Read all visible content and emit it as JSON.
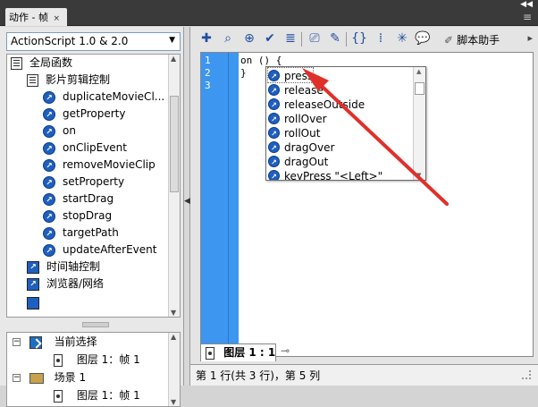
{
  "window": {
    "panel_tab_title": "动作 - 帧",
    "tab_close_glyph": "×",
    "collapse_glyph": "◀◀",
    "menu_glyph": "≡"
  },
  "left_panel": {
    "version_dropdown": {
      "selected": "ActionScript 1.0 & 2.0"
    },
    "tree": {
      "items": [
        {
          "label": "全局函数",
          "icon": "book-icon",
          "level": 0
        },
        {
          "label": "影片剪辑控制",
          "icon": "book-icon",
          "level": 1
        },
        {
          "label": "duplicateMovieCl...",
          "icon": "function-icon",
          "level": 2
        },
        {
          "label": "getProperty",
          "icon": "function-icon",
          "level": 2
        },
        {
          "label": "on",
          "icon": "function-icon",
          "level": 2
        },
        {
          "label": "onClipEvent",
          "icon": "function-icon",
          "level": 2
        },
        {
          "label": "removeMovieClip",
          "icon": "function-icon",
          "level": 2
        },
        {
          "label": "setProperty",
          "icon": "function-icon",
          "level": 2
        },
        {
          "label": "startDrag",
          "icon": "function-icon",
          "level": 2
        },
        {
          "label": "stopDrag",
          "icon": "function-icon",
          "level": 2
        },
        {
          "label": "targetPath",
          "icon": "function-icon",
          "level": 2
        },
        {
          "label": "updateAfterEvent",
          "icon": "function-icon",
          "level": 2
        },
        {
          "label": "时间轴控制",
          "icon": "book-icon-blue",
          "level": 1
        },
        {
          "label": "浏览器/网络",
          "icon": "book-icon-blue",
          "level": 1
        }
      ]
    },
    "scope_tree": {
      "items": [
        {
          "label": "当前选择",
          "icon": "selection-icon",
          "level": 0
        },
        {
          "label": "图层 1：帧 1",
          "icon": "layer-icon",
          "level": 1
        },
        {
          "label": "场景 1",
          "icon": "scene-icon",
          "level": 0
        },
        {
          "label": "图层 1：帧 1",
          "icon": "layer-icon",
          "level": 1
        }
      ]
    }
  },
  "toolbar": {
    "script_assist_label": "脚本助手",
    "buttons": [
      "add-icon",
      "find-icon",
      "target-icon",
      "check-syntax-icon",
      "auto-format-icon",
      "code-hint-icon",
      "debug-options-icon",
      "collapse-braces-icon",
      "collapse-selection-icon",
      "expand-all-icon",
      "comment-icon"
    ]
  },
  "editor": {
    "line_numbers": [
      "1",
      "2",
      "3"
    ],
    "lines": [
      "on () {",
      "}",
      ""
    ],
    "code_hints": [
      "press",
      "release",
      "releaseOutside",
      "rollOver",
      "rollOut",
      "dragOver",
      "dragOut",
      "keyPress \"<Left>\""
    ],
    "selected_hint": "press"
  },
  "layer_tab": {
    "label": "图层 1 : 1"
  },
  "status": {
    "text": "第 1 行(共 3 行)，第 5 列"
  },
  "colors": {
    "gutter": "#3d96f0",
    "arrow": "#e0302a",
    "titlebar": "#3a3a3a"
  }
}
